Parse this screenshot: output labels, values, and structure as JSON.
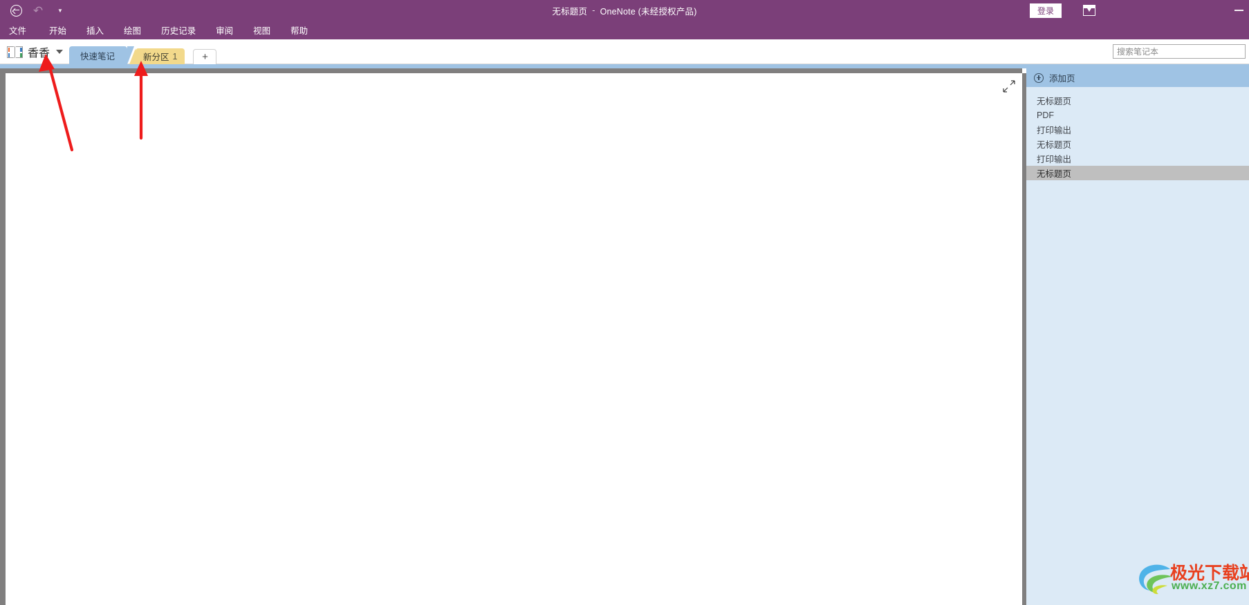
{
  "window": {
    "title_page": "无标题页",
    "title_dash": "-",
    "title_app": "OneNote (未经授权产品)",
    "signin_label": "登录",
    "accent_color": "#7b3f79"
  },
  "quick_access": {
    "back_icon": "back-circle-icon",
    "undo_icon": "undo-icon",
    "customize_icon": "chevron-down-icon"
  },
  "menubar": {
    "items": [
      {
        "label": "文件"
      },
      {
        "label": "开始"
      },
      {
        "label": "插入"
      },
      {
        "label": "绘图"
      },
      {
        "label": "历史记录"
      },
      {
        "label": "审阅"
      },
      {
        "label": "视图"
      },
      {
        "label": "帮助"
      }
    ]
  },
  "notebook": {
    "name": "香香",
    "icon": "notebook-icon",
    "caret_icon": "chevron-down-icon"
  },
  "sections": {
    "tabs": [
      {
        "label": "快速笔记",
        "badge": "",
        "color": "#9fc3e4",
        "selected": true
      },
      {
        "label": "新分区",
        "badge": "1",
        "color": "#f2d98b",
        "selected": false
      }
    ],
    "add_label": "+"
  },
  "search": {
    "placeholder": "搜索笔记本",
    "value": ""
  },
  "canvas": {
    "expand_icon": "expand-arrows-icon"
  },
  "page_list": {
    "add_page_label": "添加页",
    "add_page_icon": "plus-circle-icon",
    "pages": [
      {
        "label": "无标题页",
        "selected": false
      },
      {
        "label": "PDF",
        "selected": false
      },
      {
        "label": "打印输出",
        "selected": false
      },
      {
        "label": "无标题页",
        "selected": false
      },
      {
        "label": "打印输出",
        "selected": false
      },
      {
        "label": "无标题页",
        "selected": true
      }
    ]
  },
  "annotations": {
    "arrow_color": "#ee1c1c",
    "arrows": [
      {
        "name": "arrow-to-notebook",
        "points_to": "香香"
      },
      {
        "name": "arrow-to-section-tab",
        "points_to": "新分区 1"
      }
    ]
  },
  "watermark": {
    "site_name": "极光下载站",
    "site_url": "www.xz7.com"
  }
}
